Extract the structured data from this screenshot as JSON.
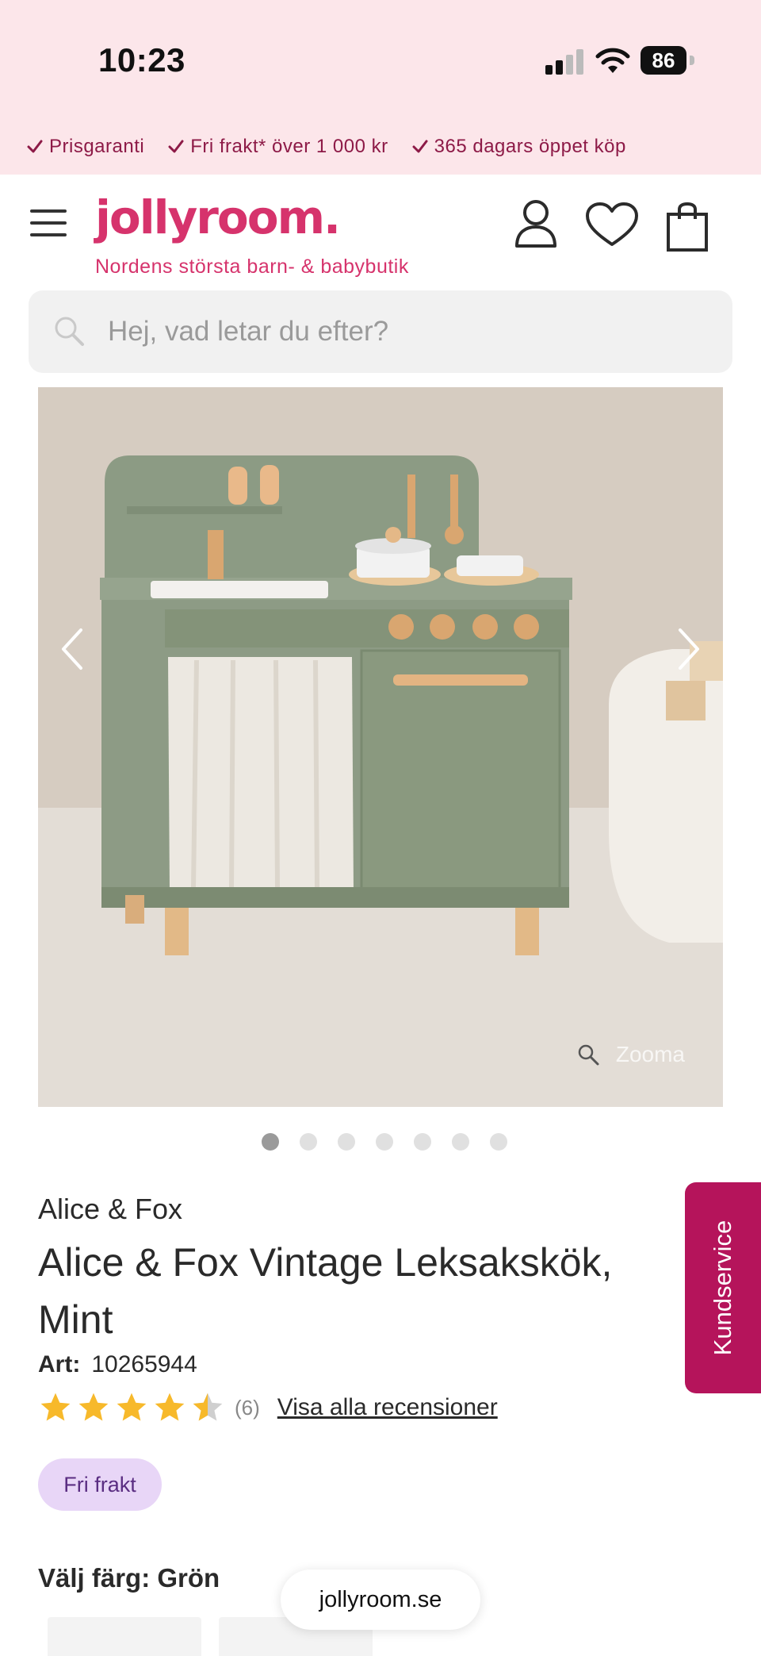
{
  "status_bar": {
    "time": "10:23",
    "battery": "86"
  },
  "usp": [
    {
      "label": "Prisgaranti"
    },
    {
      "label": "Fri frakt* över 1 000 kr"
    },
    {
      "label": "365 dagars öppet köp"
    }
  ],
  "header": {
    "logo": "jollyroom.",
    "tagline": "Nordens största barn- & babybutik"
  },
  "search": {
    "placeholder": "Hej, vad letar du efter?"
  },
  "gallery": {
    "zoom_label": "Zooma",
    "image_count": 7,
    "active_index": 0
  },
  "product": {
    "brand": "Alice & Fox",
    "title": "Alice & Fox Vintage Leksakskök, Mint",
    "art_label": "Art:",
    "art_number": "10265944",
    "rating": 4.5,
    "review_count": "(6)",
    "reviews_link": "Visa alla recensioner",
    "badge": "Fri frakt",
    "color_label": "Välj färg: Grön"
  },
  "kundservice": "Kundservice",
  "url_pill": "jollyroom.se",
  "colors": {
    "top_bar_bg": "#fce6ea",
    "usp_text": "#8d1a47",
    "brand_pink": "#d6336c",
    "kundservice_bg": "#b5145b",
    "badge_bg": "#e8d6f7",
    "star": "#f7b92b"
  }
}
